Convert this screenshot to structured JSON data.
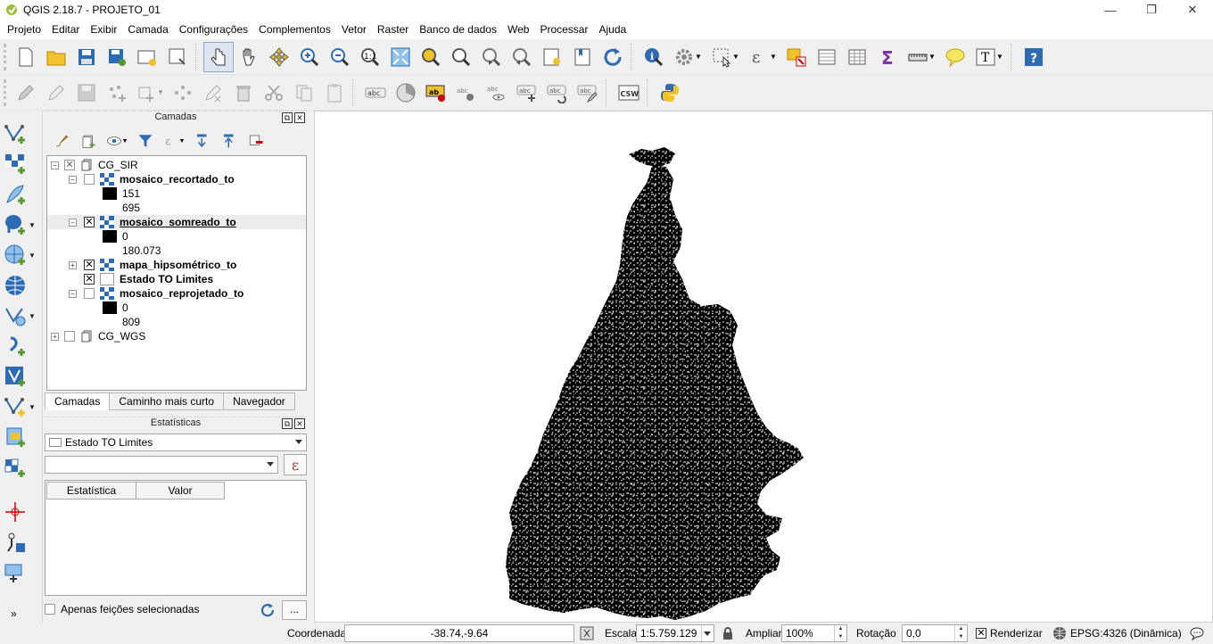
{
  "window": {
    "title": "QGIS 2.18.7 - PROJETO_01"
  },
  "menu": [
    "Projeto",
    "Editar",
    "Exibir",
    "Camada",
    "Configurações",
    "Complementos",
    "Vetor",
    "Raster",
    "Banco de dados",
    "Web",
    "Processar",
    "Ajuda"
  ],
  "toolbar2": {
    "csw_label": "CSW",
    "abc_label": "abc",
    "ab_label": "ab"
  },
  "layers_panel": {
    "title": "Camadas",
    "groups": [
      {
        "name": "CG_SIR"
      },
      {
        "name": "CG_WGS"
      }
    ],
    "items": [
      {
        "name": "mosaico_recortado_to",
        "checked": false,
        "min": "151",
        "max": "695"
      },
      {
        "name": "mosaico_somreado_to",
        "checked": true,
        "min": "0",
        "max": "180.073"
      },
      {
        "name": "mapa_hipsométrico_to",
        "checked": true
      },
      {
        "name": "Estado TO Limites",
        "checked": true
      },
      {
        "name": "mosaico_reprojetado_to",
        "checked": false,
        "min": "0",
        "max": "809"
      }
    ]
  },
  "tabs": [
    "Camadas",
    "Caminho mais curto",
    "Navegador"
  ],
  "stats_panel": {
    "title": "Estatísticas",
    "layer_combo": "Estado TO Limites",
    "field_combo": "",
    "epsilon": "ε",
    "headers": [
      "Estatística",
      "Valor"
    ],
    "selected_only": "Apenas feições selecionadas",
    "more_button": "..."
  },
  "status": {
    "coord_label": "Coordenada",
    "coord_value": "-38.74,-9.64",
    "scale_label": "Escala",
    "scale_value": "1:5.759.129",
    "magnifier_label": "Ampliar",
    "magnifier_value": "100%",
    "rotation_label": "Rotação",
    "rotation_value": "0,0",
    "render_label": "Renderizar",
    "crs_label": "EPSG:4326 (Dinâmica)"
  },
  "icons": {
    "brand": "#589632",
    "accent_yellow": "#f2c22b",
    "accent_blue": "#2d6bb5"
  }
}
